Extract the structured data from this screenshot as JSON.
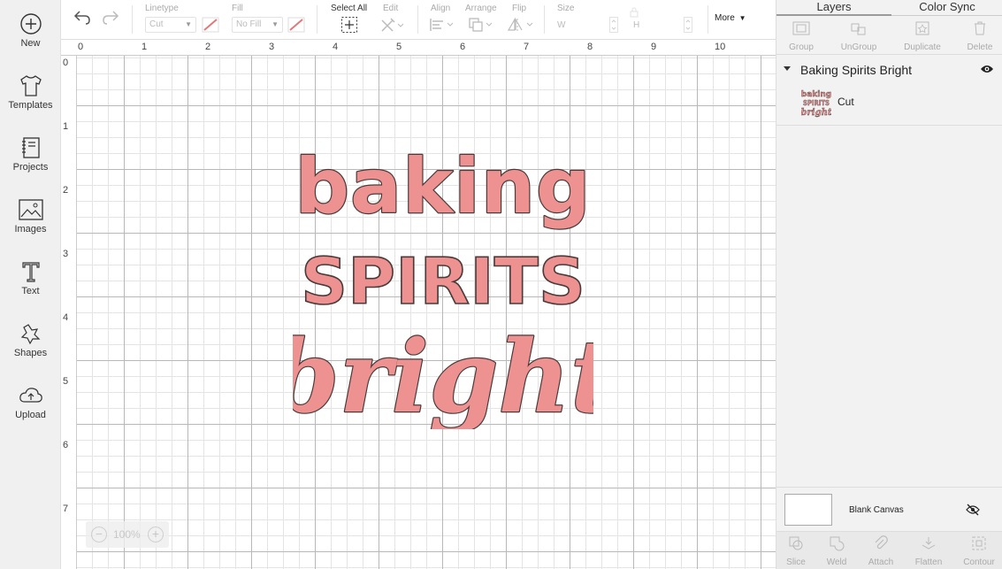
{
  "sidebar": {
    "items": [
      {
        "label": "New",
        "icon": "plus-circle-icon"
      },
      {
        "label": "Templates",
        "icon": "tshirt-icon"
      },
      {
        "label": "Projects",
        "icon": "notebook-icon"
      },
      {
        "label": "Images",
        "icon": "image-icon"
      },
      {
        "label": "Text",
        "icon": "text-icon"
      },
      {
        "label": "Shapes",
        "icon": "shapes-icon"
      },
      {
        "label": "Upload",
        "icon": "cloud-upload-icon"
      }
    ]
  },
  "toolbar": {
    "undo_icon": "undo-icon",
    "redo_icon": "redo-icon",
    "linetype_label": "Linetype",
    "linetype_value": "Cut",
    "fill_label": "Fill",
    "fill_value": "No Fill",
    "select_all_label": "Select All",
    "edit_label": "Edit",
    "align_label": "Align",
    "arrange_label": "Arrange",
    "flip_label": "Flip",
    "size_label": "Size",
    "size_w": "W",
    "size_h": "H",
    "more_label": "More"
  },
  "canvas": {
    "ruler_top": [
      "0",
      "1",
      "2",
      "3",
      "4",
      "5",
      "6",
      "7",
      "8",
      "9",
      "10"
    ],
    "ruler_left": [
      "0",
      "1",
      "2",
      "3",
      "4",
      "5",
      "6",
      "7"
    ],
    "artwork_text": [
      "baking",
      "SPIRITS",
      "bright"
    ],
    "artwork_fill": "#ee9291",
    "artwork_stroke": "#4a3a3a",
    "zoom_value": "100%"
  },
  "panel": {
    "tabs": [
      "Layers",
      "Color Sync"
    ],
    "actions": [
      "Group",
      "UnGroup",
      "Duplicate",
      "Delete"
    ],
    "layer_group_name": "Baking Spirits Bright",
    "layer_item_label": "Cut",
    "layer_thumb_text": [
      "baking",
      "SPIRITS",
      "bright"
    ],
    "blank_canvas_label": "Blank Canvas",
    "bottom_actions": [
      "Slice",
      "Weld",
      "Attach",
      "Flatten",
      "Contour"
    ]
  }
}
